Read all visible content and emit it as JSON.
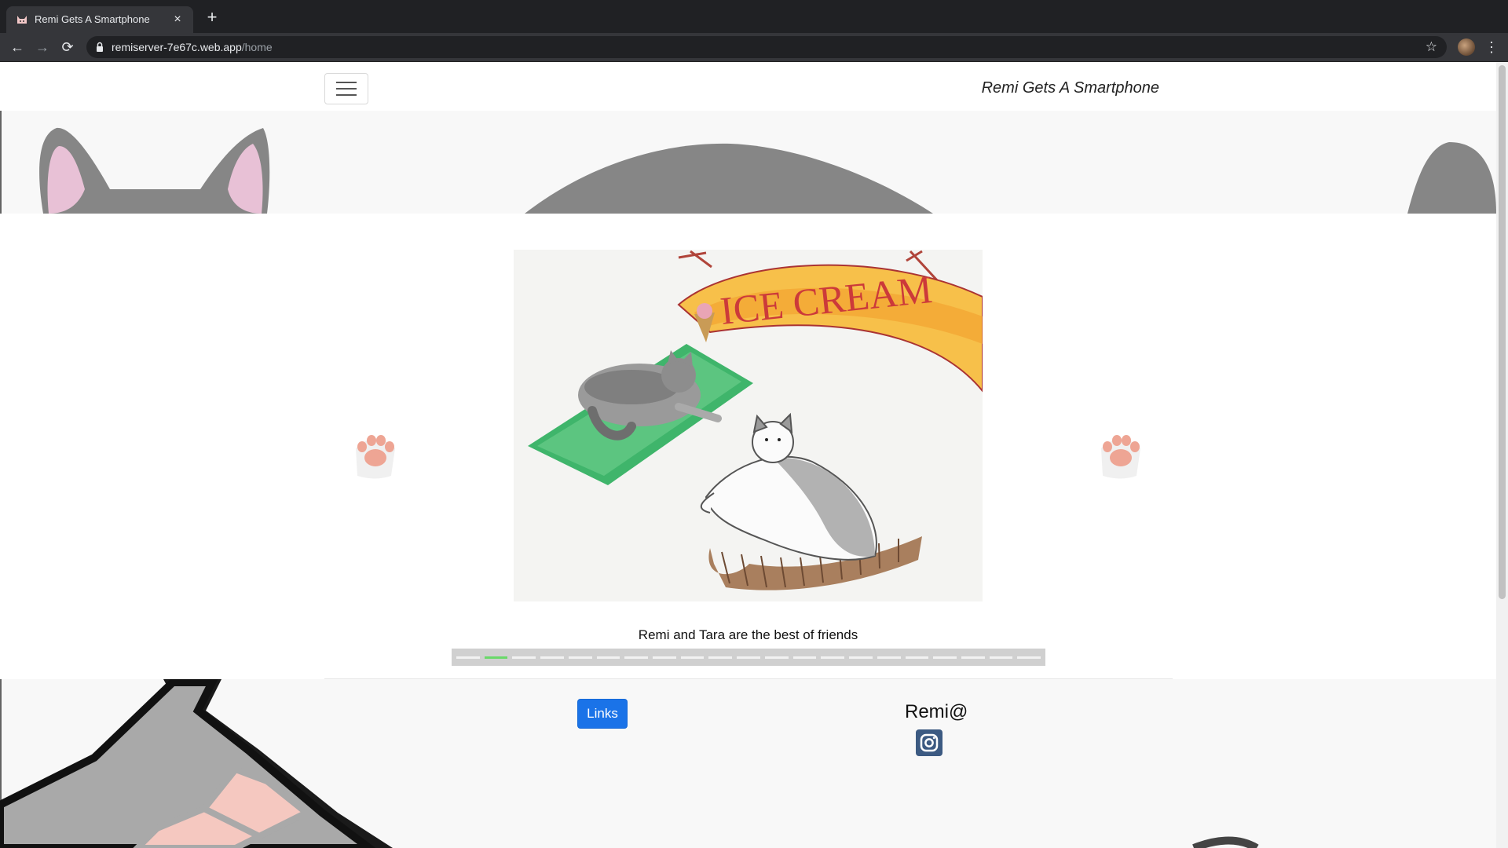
{
  "browser": {
    "tab_title": "Remi Gets A Smartphone",
    "tab_close": "×",
    "new_tab": "+",
    "url_host": "remiserver-7e67c.web.app",
    "url_path": "/home",
    "back": "←",
    "forward": "→",
    "reload": "⟳",
    "star": "☆",
    "menu": "⋮"
  },
  "navbar": {
    "brand": "Remi Gets A Smartphone"
  },
  "carousel": {
    "caption": "Remi and Tara are the best of friends",
    "slide_count": 21,
    "active_slide": 2
  },
  "footer": {
    "links_button": "Links",
    "remi_handle": "Remi@"
  },
  "colors": {
    "brand_blue": "#1a73e8",
    "indicator_active": "#6ad96a",
    "instagram_bg": "#3c5a82",
    "banner_cat_gray": "#868686",
    "ear_pink": "#e8c1d6"
  }
}
